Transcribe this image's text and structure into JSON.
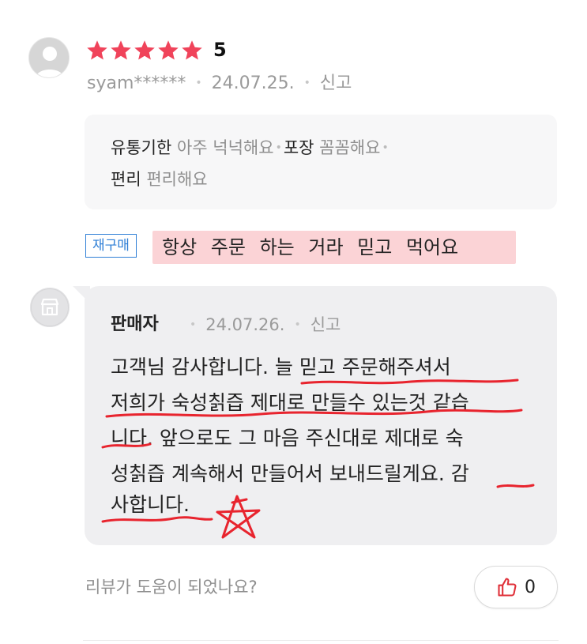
{
  "review": {
    "rating": "5",
    "stars_filled": 5,
    "star_color": "#f0435a",
    "username": "syam******",
    "date": "24.07.25.",
    "report_label": "신고",
    "attributes": {
      "line1": [
        {
          "key": "유통기한",
          "value": "아주 넉넉해요"
        },
        {
          "key": "포장",
          "value": "꼼꼼해요"
        }
      ],
      "line2": [
        {
          "key": "편리",
          "value": "편리해요"
        }
      ]
    },
    "repurchase_badge": "재구매",
    "text": "항상 주문 하는 거라 믿고 먹어요"
  },
  "seller_reply": {
    "name": "판매자",
    "date": "24.07.26.",
    "report_label": "신고",
    "lines": [
      "고객님 감사합니다. 늘 믿고 주문해주셔서",
      "저희가 숙성칡즙 제대로 만들수 있는것 같습",
      "니다. 앞으로도 그 마음 주신대로 제대로 숙",
      "성칡즙 계속해서 만들어서 보내드릴게요. 감",
      "사합니다."
    ]
  },
  "footer": {
    "helpful_question": "리뷰가 도움이 되었나요?",
    "like_count": "0",
    "like_icon": "thumbs-up-icon",
    "like_icon_color": "#e0313a"
  },
  "annotation_color": "#e8242e",
  "highlight_color": "#fbd3d6"
}
